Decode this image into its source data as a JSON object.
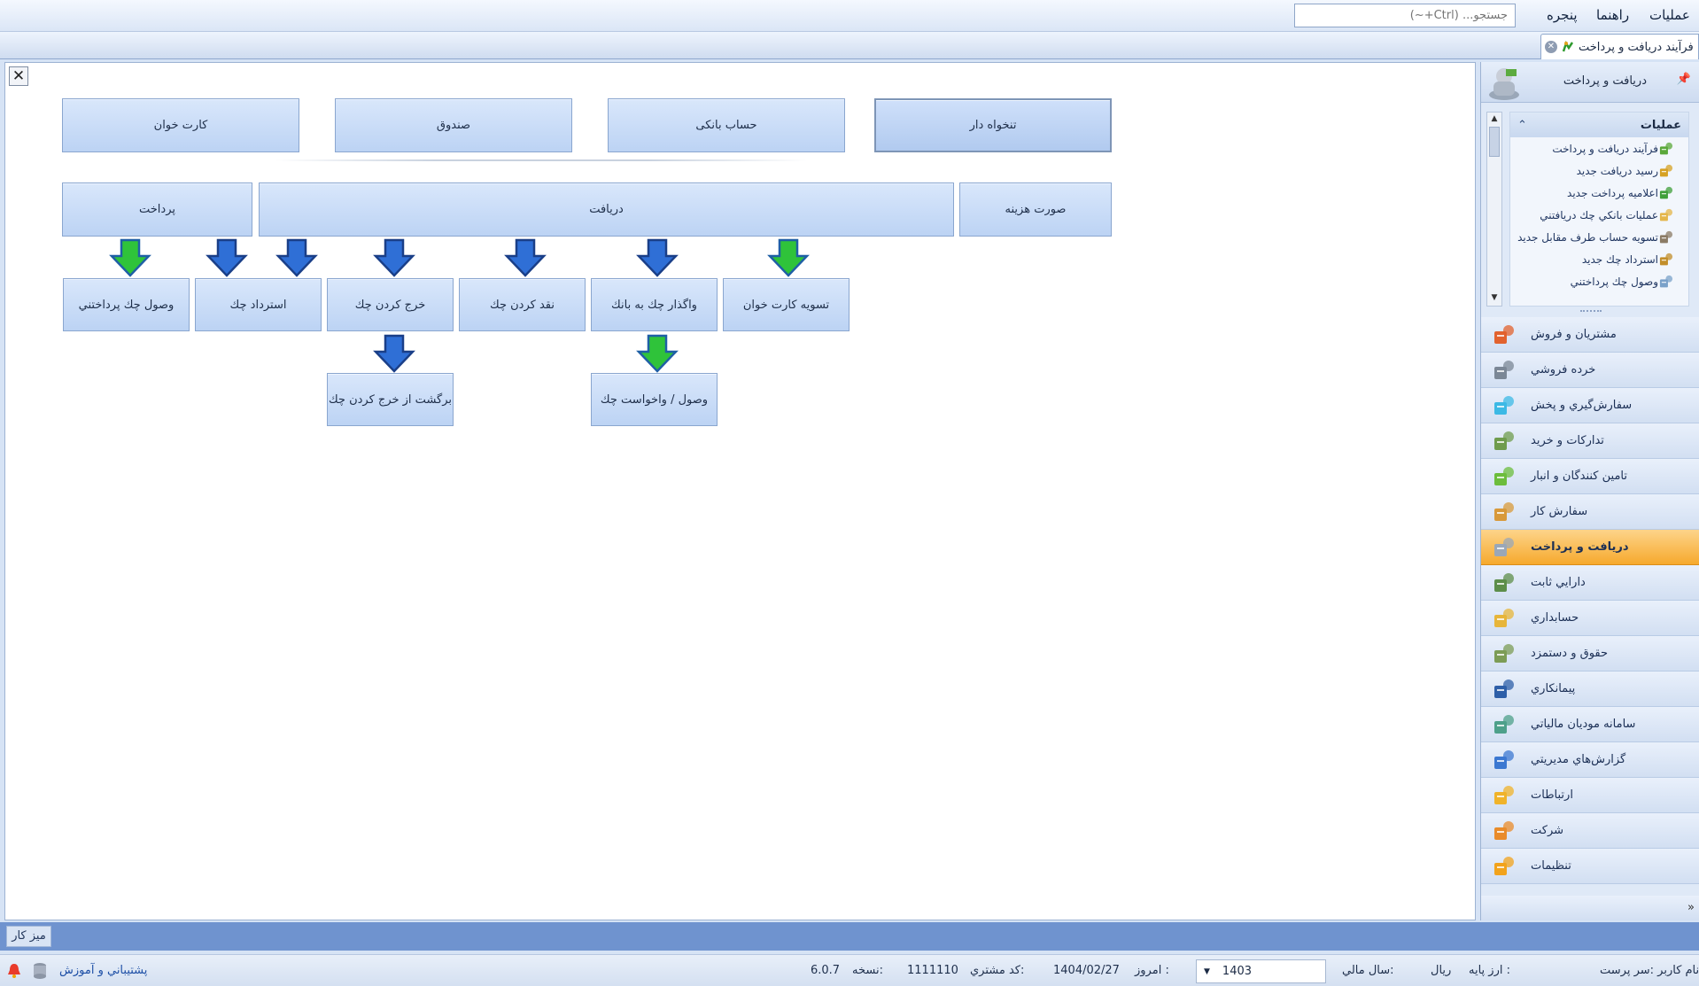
{
  "menu": {
    "operations": "عملیات",
    "help": "راهنما",
    "window": "پنجره",
    "search_placeholder": "جستجو... (Ctrl+~)"
  },
  "doc_tab": {
    "label": "فرآیند دریافت و پرداخت"
  },
  "process": {
    "accounts": [
      "تنخواه دار",
      "حساب بانکی",
      "صندوق",
      "کارت خوان"
    ],
    "groups": {
      "expense": "صورت هزینه",
      "receive": "دریافت",
      "pay": "پرداخت"
    },
    "steps": {
      "card_settle": "تسویه کارت خوان",
      "deposit_cheque": "واگذار چك به بانك",
      "cash_cheque": "نقد کردن چك",
      "spend_cheque": "خرج کردن چك",
      "return_cheque": "استرداد چك",
      "receive_paid_cheque": "وصول چك پرداختني",
      "collect_cheque": "وصول / واخواست چك",
      "spend_return": "برگشت از خرج کردن چك"
    }
  },
  "panel": {
    "header_title": "دریافت و پرداخت",
    "ops_title": "عملیات",
    "ops_items": [
      {
        "label": "فرآیند دریافت و پرداخت",
        "icon": "process-icon"
      },
      {
        "label": "رسید دریافت جدید",
        "icon": "receipt-icon"
      },
      {
        "label": "اعلامیه پرداخت جدید",
        "icon": "payment-notice-icon"
      },
      {
        "label": "عملیات بانکي چك دریافتني",
        "icon": "bank-cheque-icon"
      },
      {
        "label": "تسویه حساب طرف مقابل جدید",
        "icon": "settlement-icon"
      },
      {
        "label": "استرداد چك جدید",
        "icon": "cheque-return-icon"
      },
      {
        "label": "وصول چك پرداختني",
        "icon": "cheque-collect-icon"
      }
    ],
    "nav_items": [
      {
        "label": "مشتریان و فروش",
        "icon": "sales-chart-icon"
      },
      {
        "label": "خرده فروشي",
        "icon": "cart-icon"
      },
      {
        "label": "سفارش‌گیري و پخش",
        "icon": "distribution-icon"
      },
      {
        "label": "تدارکات و خرید",
        "icon": "purchase-icon"
      },
      {
        "label": "تامین کنندگان و انبار",
        "icon": "warehouse-icon"
      },
      {
        "label": "سفارش کار",
        "icon": "work-order-icon"
      },
      {
        "label": "دریافت و پرداخت",
        "icon": "receive-pay-icon",
        "active": true
      },
      {
        "label": "دارایي ثابت",
        "icon": "fixed-asset-icon"
      },
      {
        "label": "حسابداري",
        "icon": "accounting-icon"
      },
      {
        "label": "حقوق و دستمزد",
        "icon": "payroll-icon"
      },
      {
        "label": "پیمانکاري",
        "icon": "contracting-icon"
      },
      {
        "label": "سامانه مودیان مالیاتي",
        "icon": "tax-system-icon"
      },
      {
        "label": "گزارش‌هاي مدیریتي",
        "icon": "reports-icon"
      },
      {
        "label": "ارتباطات",
        "icon": "communications-icon"
      },
      {
        "label": "شرکت",
        "icon": "company-icon"
      },
      {
        "label": "تنظیمات",
        "icon": "settings-icon"
      }
    ]
  },
  "desk": {
    "tab_label": "میز کار"
  },
  "status": {
    "user": "نام کاربر :سر پرست",
    "base_currency_label": "ارز پایه :",
    "base_currency": "ریال",
    "fiscal_year_label": "سال مالي:",
    "fiscal_year": "1403",
    "today_label": "امروز :",
    "today": "1404/02/27",
    "customer_code_label": "کد مشتري:",
    "customer_code": "1111110",
    "version_label": "نسخه:",
    "version": "6.0.7",
    "support": "پشتيباني و آموزش"
  },
  "colors": {
    "accent_active": "#f6a92d",
    "arrow_green": "#2fc33a",
    "arrow_blue": "#2f6fd6"
  }
}
